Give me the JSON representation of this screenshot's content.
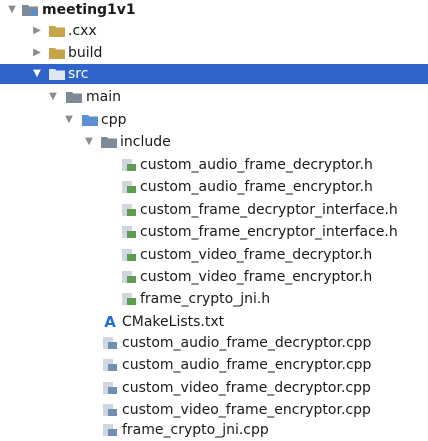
{
  "colors": {
    "selection": "#2f65ca",
    "folder": "#7e8a96",
    "arrow": "#8c8c8c",
    "cmake": "#1f6fd6"
  },
  "tree": {
    "root": {
      "label": "meeting1v1",
      "icon": "module-folder-icon",
      "state": "expanded"
    },
    "cxx": {
      "label": ".cxx",
      "icon": "folder-icon",
      "state": "collapsed"
    },
    "build": {
      "label": "build",
      "icon": "folder-icon",
      "state": "collapsed"
    },
    "src": {
      "label": "src",
      "icon": "folder-icon",
      "state": "expanded",
      "selected": true
    },
    "main": {
      "label": "main",
      "icon": "folder-icon",
      "state": "expanded"
    },
    "cpp": {
      "label": "cpp",
      "icon": "source-folder-icon",
      "state": "expanded"
    },
    "include": {
      "label": "include",
      "icon": "folder-icon",
      "state": "expanded"
    },
    "headers": [
      {
        "label": "custom_audio_frame_decryptor.h",
        "icon": "cpp-header-file-icon"
      },
      {
        "label": "custom_audio_frame_encryptor.h",
        "icon": "cpp-header-file-icon"
      },
      {
        "label": "custom_frame_decryptor_interface.h",
        "icon": "cpp-header-file-icon"
      },
      {
        "label": "custom_frame_encryptor_interface.h",
        "icon": "cpp-header-file-icon"
      },
      {
        "label": "custom_video_frame_decryptor.h",
        "icon": "cpp-header-file-icon"
      },
      {
        "label": "custom_video_frame_encryptor.h",
        "icon": "cpp-header-file-icon"
      },
      {
        "label": "frame_crypto_jni.h",
        "icon": "cpp-header-file-icon"
      }
    ],
    "cmake": {
      "label": "CMakeLists.txt",
      "icon": "cmake-icon"
    },
    "sources": [
      {
        "label": "custom_audio_frame_decryptor.cpp",
        "icon": "cpp-source-file-icon"
      },
      {
        "label": "custom_audio_frame_encryptor.cpp",
        "icon": "cpp-source-file-icon"
      },
      {
        "label": "custom_video_frame_decryptor.cpp",
        "icon": "cpp-source-file-icon"
      },
      {
        "label": "custom_video_frame_encryptor.cpp",
        "icon": "cpp-source-file-icon"
      },
      {
        "label": "frame_crypto_jni.cpp",
        "icon": "cpp-source-file-icon"
      }
    ]
  }
}
